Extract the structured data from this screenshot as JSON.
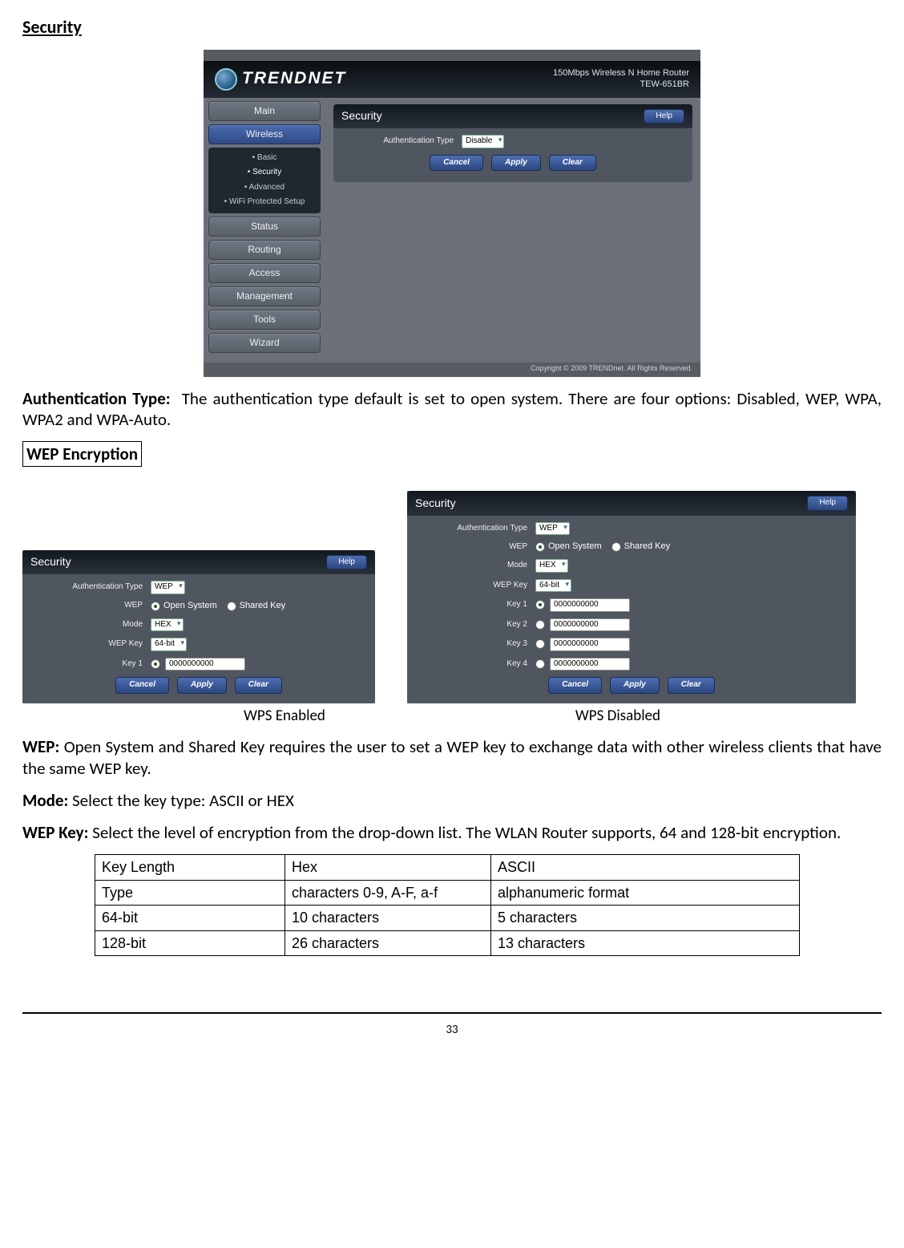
{
  "doc": {
    "page_title": "Security",
    "auth_label": "Authentication Type:",
    "auth_text": "The authentication type default is set to open system. There are four options: Disabled, WEP, WPA, WPA2 and WPA-Auto.",
    "wep_enc_title": "WEP Encryption",
    "caption_a": "WPS Enabled",
    "caption_b": "WPS Disabled",
    "wep_label": "WEP:",
    "wep_text": "Open System and Shared Key requires the user to set a WEP key to exchange data with other wireless clients that have the same WEP key.",
    "mode_label": "Mode:",
    "mode_text": "Select the key type: ASCII or HEX",
    "wepkey_label": "WEP Key:",
    "wepkey_text": "Select the level of encryption from the drop-down list. The WLAN Router supports, 64 and 128-bit encryption.",
    "page_num": "33"
  },
  "router": {
    "brand": "TRENDNET",
    "model_line1": "150Mbps Wireless N Home Router",
    "model_line2": "TEW-651BR",
    "copyright": "Copyright © 2009 TRENDnet. All Rights Reserved.",
    "nav": [
      "Main",
      "Wireless",
      "Status",
      "Routing",
      "Access",
      "Management",
      "Tools",
      "Wizard"
    ],
    "subnav": [
      "Basic",
      "Security",
      "Advanced",
      "WiFi Protected Setup"
    ],
    "panel_title": "Security",
    "help": "Help",
    "auth_label": "Authentication Type",
    "auth_value": "Disable",
    "btns": [
      "Cancel",
      "Apply",
      "Clear"
    ]
  },
  "shot_a": {
    "panel_title": "Security",
    "help": "Help",
    "rows": {
      "auth_label": "Authentication Type",
      "auth_value": "WEP",
      "wep_label": "WEP",
      "wep_opt1": "Open System",
      "wep_opt2": "Shared Key",
      "mode_label": "Mode",
      "mode_value": "HEX",
      "wepkey_label": "WEP Key",
      "wepkey_value": "64-bit",
      "key1_label": "Key 1",
      "key1_value": "0000000000"
    },
    "btns": [
      "Cancel",
      "Apply",
      "Clear"
    ]
  },
  "shot_b": {
    "panel_title": "Security",
    "help": "Help",
    "rows": {
      "auth_label": "Authentication Type",
      "auth_value": "WEP",
      "wep_label": "WEP",
      "wep_opt1": "Open System",
      "wep_opt2": "Shared Key",
      "mode_label": "Mode",
      "mode_value": "HEX",
      "wepkey_label": "WEP Key",
      "wepkey_value": "64-bit",
      "key1_label": "Key 1",
      "key1_value": "0000000000",
      "key2_label": "Key 2",
      "key2_value": "0000000000",
      "key3_label": "Key 3",
      "key3_value": "0000000000",
      "key4_label": "Key 4",
      "key4_value": "0000000000"
    },
    "btns": [
      "Cancel",
      "Apply",
      "Clear"
    ]
  },
  "table": {
    "r1c1": "Key Length",
    "r1c2": "Hex",
    "r1c3": "ASCII",
    "r2c1": "Type",
    "r2c2": "characters 0-9, A-F, a-f",
    "r2c3": "alphanumeric format",
    "r3c1": "64-bit",
    "r3c2": "10 characters",
    "r3c3": "5 characters",
    "r4c1": "128-bit",
    "r4c2": "26 characters",
    "r4c3": "13 characters"
  }
}
